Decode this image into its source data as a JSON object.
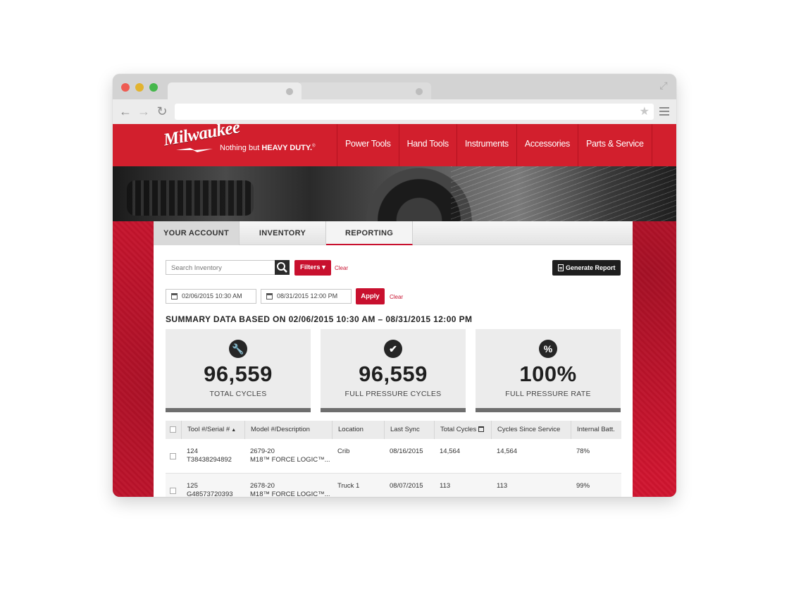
{
  "brand": {
    "logo_text": "Milwaukee",
    "tagline_prefix": "Nothing but",
    "tagline_strong": "HEAVY DUTY.",
    "tagline_mark": "®"
  },
  "nav": {
    "items": [
      "Power Tools",
      "Hand Tools",
      "Instruments",
      "Accessories",
      "Parts & Service"
    ]
  },
  "account_tabs": [
    "YOUR ACCOUNT",
    "INVENTORY",
    "REPORTING"
  ],
  "search": {
    "placeholder": "Search Inventory"
  },
  "filters": {
    "label": "Filters ▾",
    "clear": "Clear"
  },
  "generate_report": {
    "label": "Generate Report"
  },
  "date_range": {
    "start": "02/06/2015 10:30 AM",
    "end": "08/31/2015 12:00 PM",
    "apply": "Apply",
    "clear": "Clear"
  },
  "summary": {
    "title": "SUMMARY DATA BASED ON 02/06/2015 10:30 AM – 08/31/2015 12:00 PM",
    "cards": [
      {
        "icon": "wrench-icon",
        "value": "96,559",
        "label": "TOTAL CYCLES"
      },
      {
        "icon": "check-icon",
        "value": "96,559",
        "label": "FULL PRESSURE CYCLES"
      },
      {
        "icon": "percent-icon",
        "value": "100%",
        "label": "FULL PRESSURE RATE"
      }
    ]
  },
  "table": {
    "columns": [
      "Tool #/Serial #",
      "Model #/Description",
      "Location",
      "Last Sync",
      "Total Cycles",
      "Cycles Since Service",
      "Internal Batt."
    ],
    "rows": [
      {
        "tool": "124",
        "serial": "T38438294892",
        "model": "2679-20",
        "desc": "M18™ FORCE LOGIC™...",
        "location": "Crib",
        "last_sync": "08/16/2015",
        "total_cycles": "14,564",
        "since_service": "14,564",
        "battery": "78%"
      },
      {
        "tool": "125",
        "serial": "G48573720393",
        "model": "2678-20",
        "desc": "M18™ FORCE LOGIC™...",
        "location": "Truck 1",
        "last_sync": "08/07/2015",
        "total_cycles": "113",
        "since_service": "113",
        "battery": "99%"
      }
    ]
  },
  "colors": {
    "brand_red": "#c8102e",
    "dark": "#1e1e1e"
  }
}
